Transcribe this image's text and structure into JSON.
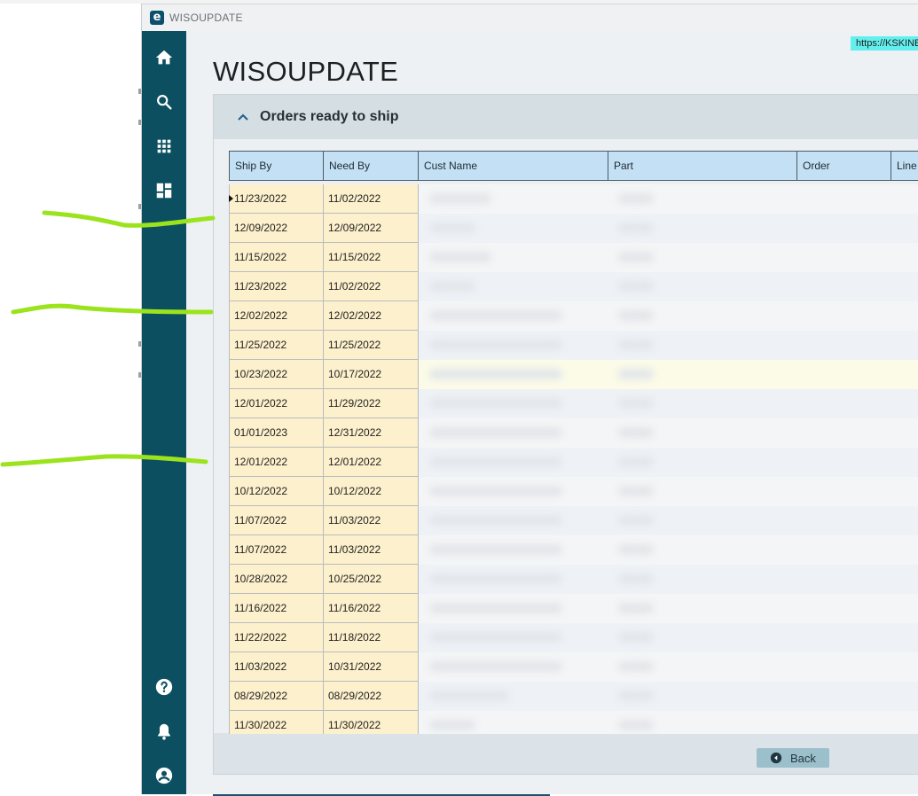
{
  "window": {
    "title": "WISOUPDATE"
  },
  "sidebar": {
    "items": [
      {
        "name": "home",
        "icon": "home-icon"
      },
      {
        "name": "search",
        "icon": "search-icon"
      },
      {
        "name": "apps",
        "icon": "apps-grid-icon"
      },
      {
        "name": "dashboard",
        "icon": "dashboard-icon"
      },
      {
        "name": "help",
        "icon": "help-icon"
      },
      {
        "name": "notifications",
        "icon": "bell-icon"
      },
      {
        "name": "account",
        "icon": "account-icon"
      }
    ]
  },
  "url_badge": "https://KSKINB",
  "page": {
    "title": "WISOUPDATE"
  },
  "panel": {
    "title": "Orders ready to ship",
    "columns": [
      "Ship By",
      "Need By",
      "Cust Name",
      "Part",
      "Order",
      "Line"
    ],
    "rows": [
      {
        "ship_by": "11/23/2022",
        "need_by": "11/02/2022"
      },
      {
        "ship_by": "12/09/2022",
        "need_by": "12/09/2022"
      },
      {
        "ship_by": "11/15/2022",
        "need_by": "11/15/2022"
      },
      {
        "ship_by": "11/23/2022",
        "need_by": "11/02/2022"
      },
      {
        "ship_by": "12/02/2022",
        "need_by": "12/02/2022"
      },
      {
        "ship_by": "11/25/2022",
        "need_by": "11/25/2022"
      },
      {
        "ship_by": "10/23/2022",
        "need_by": "10/17/2022"
      },
      {
        "ship_by": "12/01/2022",
        "need_by": "11/29/2022"
      },
      {
        "ship_by": "01/01/2023",
        "need_by": "12/31/2022"
      },
      {
        "ship_by": "12/01/2022",
        "need_by": "12/01/2022"
      },
      {
        "ship_by": "10/12/2022",
        "need_by": "10/12/2022"
      },
      {
        "ship_by": "11/07/2022",
        "need_by": "11/03/2022"
      },
      {
        "ship_by": "11/07/2022",
        "need_by": "11/03/2022"
      },
      {
        "ship_by": "10/28/2022",
        "need_by": "10/25/2022"
      },
      {
        "ship_by": "11/16/2022",
        "need_by": "11/16/2022"
      },
      {
        "ship_by": "11/22/2022",
        "need_by": "11/18/2022"
      },
      {
        "ship_by": "11/03/2022",
        "need_by": "10/31/2022"
      },
      {
        "ship_by": "08/29/2022",
        "need_by": "08/29/2022"
      },
      {
        "ship_by": "11/30/2022",
        "need_by": "11/30/2022"
      }
    ],
    "back_label": "Back"
  },
  "colors": {
    "sidebar": "#0c4f60",
    "header_cell": "#c3e0f4",
    "date_cell": "#fdf0cc",
    "url_badge": "#62f0ee",
    "annotation": "#9be31c"
  }
}
